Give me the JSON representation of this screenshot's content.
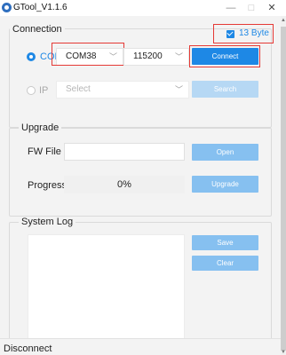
{
  "window": {
    "title": "GTool_V1.1.6",
    "minimize": "—",
    "maximize": "□",
    "close": "✕"
  },
  "connection": {
    "title": "Connection",
    "byte_option": "13 Byte",
    "byte_checked": true,
    "com_label": "COM",
    "com_selected": true,
    "com_port": "COM38",
    "baud_rate": "115200",
    "connect_label": "Connect",
    "ip_label": "IP",
    "ip_placeholder": "Select",
    "search_label": "Search"
  },
  "upgrade": {
    "title": "Upgrade",
    "fw_label": "FW File",
    "fw_value": "",
    "open_label": "Open",
    "progress_label": "Progress",
    "progress_value": "0%",
    "upgrade_label": "Upgrade"
  },
  "system_log": {
    "title": "System Log",
    "save_label": "Save",
    "clear_label": "Clear"
  },
  "status": {
    "text": "Disconnect"
  },
  "colors": {
    "accent": "#1e88e5",
    "button_idle": "#86c0f0",
    "highlight": "#e53935"
  },
  "icons": {
    "app": "gtool-app-icon",
    "chevron": "chevron-down-icon"
  }
}
